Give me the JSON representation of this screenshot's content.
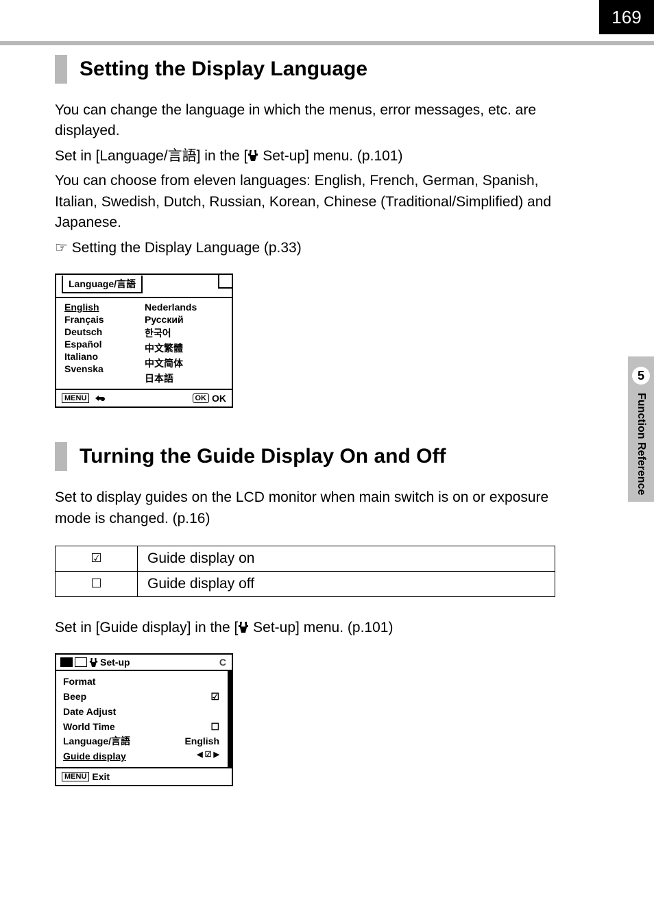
{
  "page_number": "169",
  "sidebar": {
    "chapter_number": "5",
    "chapter_title": "Function Reference"
  },
  "section1": {
    "title": "Setting the Display Language",
    "p1": "You can change the language in which the menus, error messages, etc. are displayed.",
    "p2a": "Set in [Language/言語] in the [",
    "p2b": " Set-up] menu. (p.101)",
    "p3": "You can choose from eleven languages: English, French, German, Spanish, Italian, Swedish, Dutch, Russian, Korean, Chinese (Traditional/Simplified) and Japanese.",
    "p4": "☞ Setting the Display Language (p.33)",
    "lcd": {
      "title": "Language/言語",
      "col1": [
        "English",
        "Français",
        "Deutsch",
        "Español",
        "Italiano",
        "Svenska"
      ],
      "col2": [
        "Nederlands",
        "Русский",
        "한국어",
        "中文繁體",
        "中文简体",
        "日本語"
      ],
      "footer_menu": "MENU",
      "footer_ok_box": "OK",
      "footer_ok_text": "OK"
    }
  },
  "section2": {
    "title": "Turning the Guide Display On and Off",
    "p1": "Set to display guides on the LCD monitor when main switch is on or exposure mode is changed. (p.16)",
    "table": {
      "row1_icon": "☑",
      "row1_text": "Guide display on",
      "row2_icon": "☐",
      "row2_text": "Guide display off"
    },
    "p2a": "Set in [Guide display] in the [",
    "p2b": " Set-up] menu. (p.101)",
    "lcd": {
      "tab_label": "Set-up",
      "c": "C",
      "items": [
        {
          "label": "Format",
          "value": ""
        },
        {
          "label": "Beep",
          "value": "☑"
        },
        {
          "label": "Date Adjust",
          "value": ""
        },
        {
          "label": "World Time",
          "value": "☐"
        },
        {
          "label": "Language/言語",
          "value": "English"
        },
        {
          "label": "Guide display",
          "value": "◀ ☑ ▶",
          "selected": true
        }
      ],
      "footer_menu": "MENU",
      "footer_exit": "Exit"
    }
  }
}
